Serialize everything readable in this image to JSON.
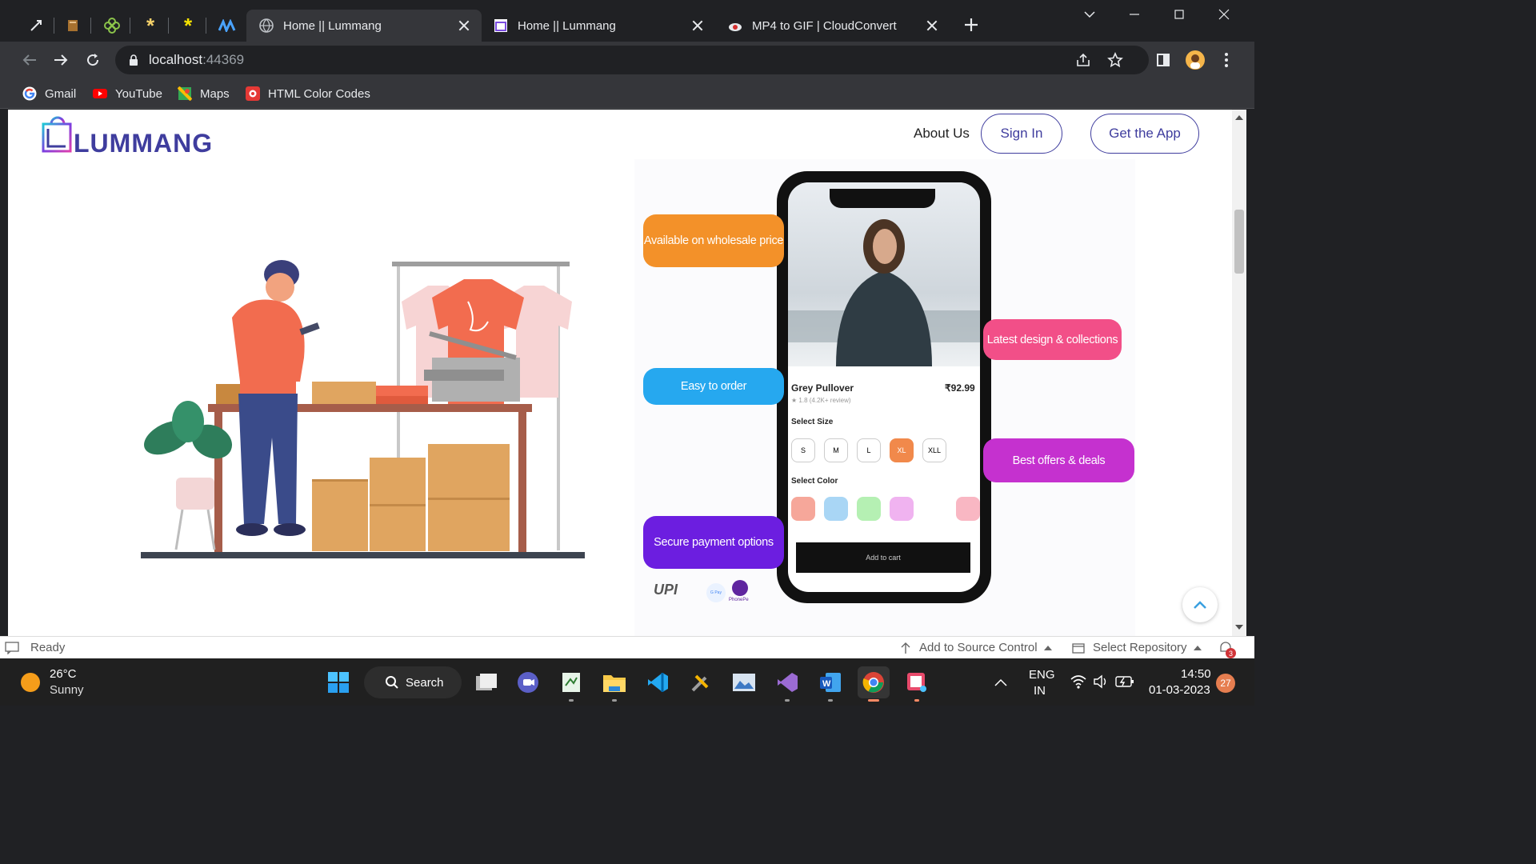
{
  "browser": {
    "tabs": [
      {
        "title": "Home || Lummang",
        "active": true
      },
      {
        "title": "Home || Lummang",
        "active": false
      },
      {
        "title": "MP4 to GIF | CloudConvert",
        "active": false
      }
    ],
    "address": {
      "host": "localhost",
      "port": ":44369"
    },
    "bookmarks": [
      "Gmail",
      "YouTube",
      "Maps",
      "HTML Color Codes"
    ]
  },
  "site": {
    "logo_text": "LUMMANG",
    "nav": {
      "about": "About Us",
      "signin": "Sign In",
      "app": "Get the App"
    },
    "bubbles": {
      "wholesale": "Available on wholesale price",
      "design": "Latest design & collections",
      "easy": "Easy to order",
      "offers": "Best offers & deals",
      "secure": "Secure payment options"
    },
    "phone": {
      "product_name": "Grey Pullover",
      "price": "92.99",
      "rating": "1.8",
      "reviews": "(4.2K+ review)",
      "select_size": "Select Size",
      "sizes": [
        "S",
        "M",
        "L",
        "XL",
        "XLL"
      ],
      "selected_size": "XL",
      "select_color": "Select Color",
      "colors": [
        "#f6a79a",
        "#a9d6f5",
        "#b5f0b3",
        "#f0b3f0",
        "#f9b7c3"
      ],
      "add_to_cart": "Add to cart"
    },
    "payments": {
      "upi": "UPI",
      "gpay": "G Pay",
      "phonepe": "PhonePe"
    }
  },
  "colors": {
    "brand": "#3f3d9e",
    "orange": "#f39129",
    "pink": "#f24f88",
    "blue": "#26a8ef",
    "magenta": "#c531cf",
    "purple": "#6c1ee0"
  },
  "statusbar": {
    "ready": "Ready",
    "source_control": "Add to Source Control",
    "repository": "Select Repository",
    "notifications": "3"
  },
  "taskbar": {
    "weather_temp": "26°C",
    "weather_desc": "Sunny",
    "search": "Search",
    "lang1": "ENG",
    "lang2": "IN",
    "time": "14:50",
    "date": "01-03-2023",
    "badge": "27"
  }
}
